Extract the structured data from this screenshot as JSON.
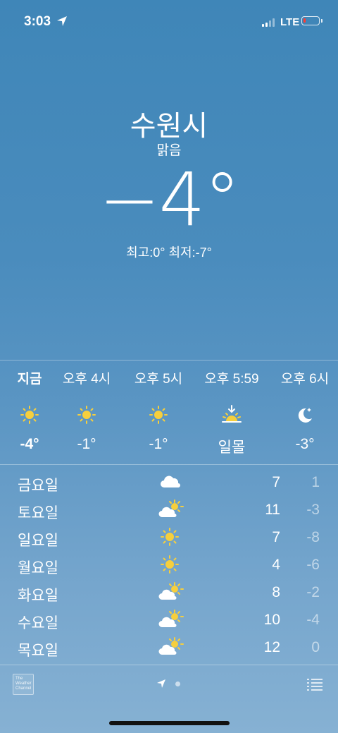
{
  "status_bar": {
    "time": "3:03",
    "network": "LTE"
  },
  "location": {
    "city": "수원시",
    "condition": "맑음",
    "temperature": "−4°",
    "high_low": "최고:0°  최저:-7°"
  },
  "hourly": [
    {
      "label": "지금",
      "icon": "sun-icon",
      "temp": "-4°",
      "bold": true
    },
    {
      "label": "오후 4시",
      "icon": "sun-icon",
      "temp": "-1°"
    },
    {
      "label": "오후 5시",
      "icon": "sun-icon",
      "temp": "-1°"
    },
    {
      "label": "오후 5:59",
      "icon": "sunset-icon",
      "temp": "일몰"
    },
    {
      "label": "오후 6시",
      "icon": "moon-icon",
      "temp": "-3°"
    }
  ],
  "daily": [
    {
      "day": "금요일",
      "icon": "cloud-icon",
      "high": "7",
      "low": "1"
    },
    {
      "day": "토요일",
      "icon": "partly-cloudy-icon",
      "high": "11",
      "low": "-3"
    },
    {
      "day": "일요일",
      "icon": "sun-icon",
      "high": "7",
      "low": "-8"
    },
    {
      "day": "월요일",
      "icon": "sun-icon",
      "high": "4",
      "low": "-6"
    },
    {
      "day": "화요일",
      "icon": "partly-cloudy-icon",
      "high": "8",
      "low": "-2"
    },
    {
      "day": "수요일",
      "icon": "partly-cloudy-icon",
      "high": "10",
      "low": "-4"
    },
    {
      "day": "목요일",
      "icon": "partly-cloudy-icon",
      "high": "12",
      "low": "0"
    }
  ],
  "footer": {
    "logo_text": "The Weather Channel"
  },
  "colors": {
    "sun": "#f6cf3d",
    "battery_low": "#ff3b30"
  }
}
